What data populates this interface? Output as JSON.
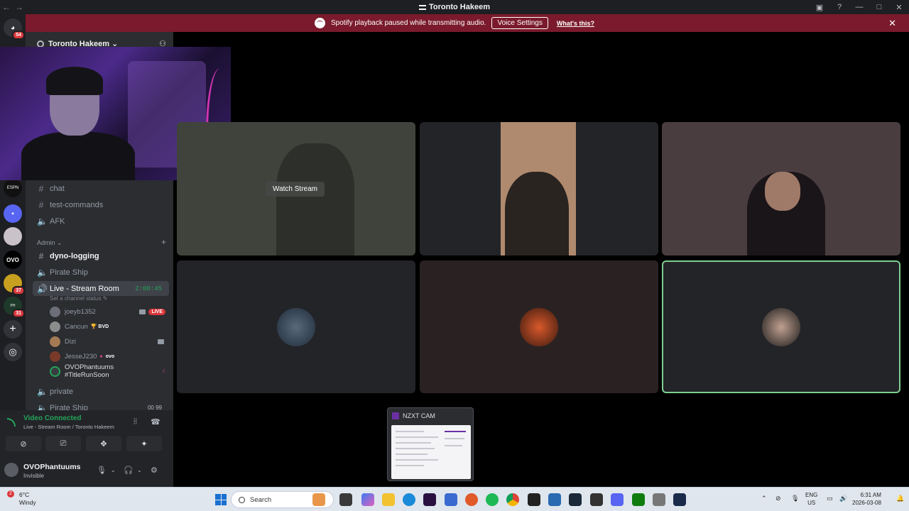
{
  "titlebar": {
    "title": "Toronto Hakeem",
    "back": "←",
    "fwd": "→"
  },
  "notice": {
    "text": "Spotify playback paused while transmitting audio.",
    "button": "Voice Settings",
    "link": "What's this?",
    "close": "✕"
  },
  "rail": {
    "dm_badge": "54",
    "badge_37": "37",
    "badge_31": "31",
    "add": "+",
    "explore": "◎"
  },
  "server": {
    "name": "Toronto Hakeem ⌄"
  },
  "channels": {
    "chat": "chat",
    "test_commands": "test-commands",
    "afk": "AFK",
    "admin_category": "Admin ⌄",
    "dyno_logging": "dyno-logging",
    "pirate_ship": "Pirate Ship",
    "live_stream_room": "Live - Stream Room",
    "live_timer": "2:00:45",
    "channel_status": "Set a channel status ✎",
    "private": "private",
    "pirate_ship_2": "Pirate Ship",
    "pirate_ship_2_count": "00 99"
  },
  "voice_users": [
    {
      "name": "joeyb1352",
      "live": "LIVE"
    },
    {
      "name": "Cancun",
      "tag": "🏆 BVD"
    },
    {
      "name": "Dizi"
    },
    {
      "name": "JesseJ230",
      "tag": "ovo"
    },
    {
      "name": "OVOPhantuums #TitleRunSoon"
    }
  ],
  "voice_panel": {
    "status": "Video Connected",
    "sub": "Live - Stream Room / Toronto Hakeem"
  },
  "me": {
    "name": "OVOPhantuums",
    "status": "Invisible"
  },
  "stream": {
    "watch": "Watch Stream"
  },
  "popup": {
    "title": "NZXT CAM"
  },
  "taskbar": {
    "temp": "6°C",
    "weather": "Windy",
    "weather_badge": "2",
    "search": "Search",
    "lang1": "ENG",
    "lang2": "US",
    "time": "6:31 AM",
    "date": "2026-03-08"
  },
  "colors": {
    "accent_green": "#23a55a",
    "notice_bg": "#7a1a2c",
    "live_red": "#da373c"
  }
}
